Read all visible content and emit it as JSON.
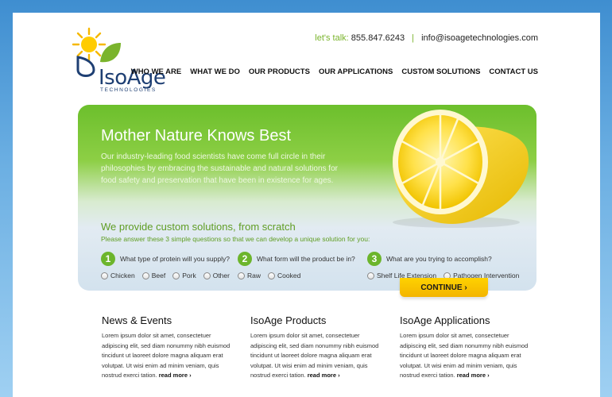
{
  "brand": {
    "name": "IsoAge",
    "tagline": "TECHNOLOGIES",
    "colors": {
      "green": "#7ab42c",
      "navy": "#1e3f73",
      "yellow": "#ffd200"
    }
  },
  "contact": {
    "label": "let's talk:",
    "phone": "855.847.6243",
    "separator": "|",
    "email": "info@isoagetechnologies.com"
  },
  "nav": {
    "items": [
      {
        "label": "WHO WE ARE"
      },
      {
        "label": "WHAT WE DO"
      },
      {
        "label": "OUR PRODUCTS"
      },
      {
        "label": "OUR APPLICATIONS"
      },
      {
        "label": "CUSTOM SOLUTIONS"
      },
      {
        "label": "CONTACT US"
      }
    ]
  },
  "hero": {
    "title": "Mother Nature Knows Best",
    "text": "Our industry-leading food scientists have come full circle in their philosophies by embracing the sustainable and natural solutions for food safety and preservation that have been in existence for ages."
  },
  "custom": {
    "title": "We provide custom solutions, from scratch",
    "subtitle": "Please answer these 3 simple questions so that we can develop a unique solution for you:",
    "questions": [
      {
        "number": "1",
        "text": "What type of protein will you supply?",
        "options": [
          "Chicken",
          "Beef",
          "Pork",
          "Other"
        ]
      },
      {
        "number": "2",
        "text": "What form will the product be in?",
        "options": [
          "Raw",
          "Cooked"
        ]
      },
      {
        "number": "3",
        "text": "What are you trying to accomplish?",
        "options": [
          "Shelf Life Extension",
          "Pathogen Intervention"
        ]
      }
    ],
    "continue_label": "CONTINUE ›"
  },
  "columns": [
    {
      "title": "News & Events",
      "body": "Lorem ipsum dolor sit amet, consectetuer adipiscing elit, sed diam nonummy nibh euismod tincidunt ut laoreet dolore magna aliquam erat volutpat. Ut wisi enim ad minim veniam, quis nostrud exerci tation.",
      "more": "read more ›"
    },
    {
      "title": "IsoAge Products",
      "body": "Lorem ipsum dolor sit amet, consectetuer adipiscing elit, sed diam nonummy nibh euismod tincidunt ut laoreet dolore magna aliquam erat volutpat. Ut wisi enim ad minim veniam, quis nostrud exerci tation.",
      "more": "read more ›"
    },
    {
      "title": "IsoAge Applications",
      "body": "Lorem ipsum dolor sit amet, consectetuer adipiscing elit, sed diam nonummy nibh euismod tincidunt ut laoreet dolore magna aliquam erat volutpat. Ut wisi enim ad minim veniam, quis nostrud exerci tation.",
      "more": "read more ›"
    }
  ]
}
